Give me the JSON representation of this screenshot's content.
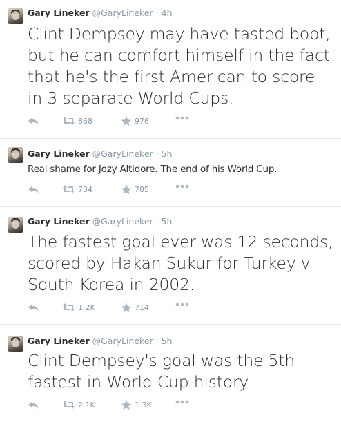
{
  "tweets": [
    {
      "name": "Gary Lineker",
      "handle": "@GaryLineker",
      "time": "4h",
      "text": "Clint Dempsey may have tasted boot, but he can comfort himself in the fact that he's the first American to score in 3 separate World Cups.",
      "retweets": "868",
      "favorites": "976"
    },
    {
      "name": "Gary Lineker",
      "handle": "@GaryLineker",
      "time": "5h",
      "text": "Real shame for Jozy Altidore. The end of his World Cup.",
      "retweets": "734",
      "favorites": "785"
    },
    {
      "name": "Gary Lineker",
      "handle": "@GaryLineker",
      "time": "5h",
      "text": "The fastest goal ever was 12 seconds, scored by Hakan Sukur for Turkey v South Korea in 2002.",
      "retweets": "1.2K",
      "favorites": "714"
    },
    {
      "name": "Gary Lineker",
      "handle": "@GaryLineker",
      "time": "5h",
      "text": "Clint Dempsey's goal was the 5th fastest in World Cup history.",
      "retweets": "2.1K",
      "favorites": "1.3K"
    }
  ],
  "icons": {
    "reply": "reply-icon",
    "retweet": "retweet-icon",
    "favorite": "star-icon",
    "more": "more-icon"
  },
  "colors": {
    "text": "#292f33",
    "muted": "#8899a6",
    "icon": "#aab8c2",
    "divider": "#e1e8ed"
  }
}
